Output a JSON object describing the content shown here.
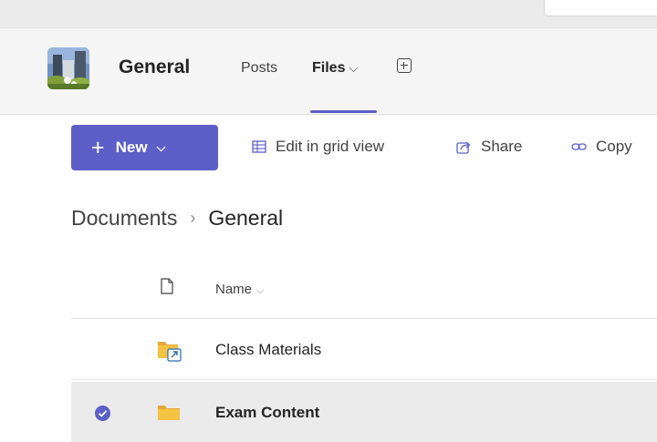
{
  "header": {
    "channel_name": "General",
    "tabs": [
      {
        "label": "Posts"
      },
      {
        "label": "Files",
        "active": true,
        "chevron": "chevron-down-icon"
      }
    ],
    "add_tab_icon": "plus-square-icon"
  },
  "toolbar": {
    "new_label": "New",
    "new_icon": "plus-icon",
    "edit_grid_label": "Edit in grid view",
    "share_label": "Share",
    "copy_label": "Copy"
  },
  "breadcrumb": {
    "root": "Documents",
    "current": "General"
  },
  "table": {
    "name_header": "Name",
    "rows": [
      {
        "name": "Class Materials",
        "icon": "shared-folder-icon",
        "selected": false
      },
      {
        "name": "Exam Content",
        "icon": "folder-icon",
        "selected": true
      }
    ]
  },
  "colors": {
    "accent": "#5b5fc7",
    "folder": "#f5c342",
    "header_bg": "#f5f5f5",
    "selected_row_bg": "#ebebeb"
  }
}
